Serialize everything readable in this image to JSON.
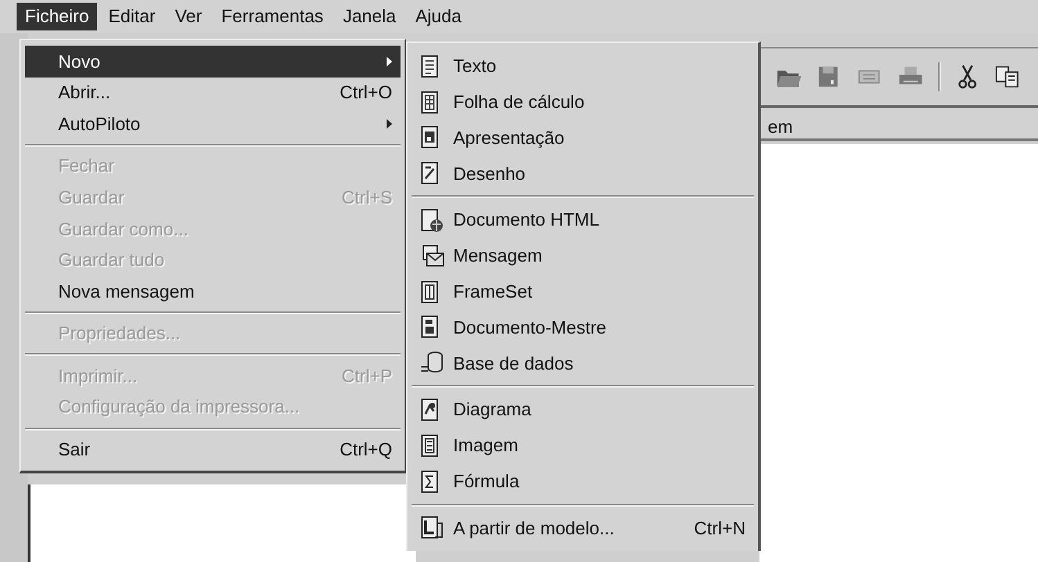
{
  "menubar": [
    {
      "label": "Ficheiro",
      "selected": true
    },
    {
      "label": "Editar",
      "selected": false
    },
    {
      "label": "Ver",
      "selected": false
    },
    {
      "label": "Ferramentas",
      "selected": false
    },
    {
      "label": "Janela",
      "selected": false
    },
    {
      "label": "Ajuda",
      "selected": false
    }
  ],
  "file_menu": [
    {
      "kind": "item",
      "label": "Novo",
      "selected": true,
      "disabled": false,
      "submenu": true
    },
    {
      "kind": "item",
      "label": "Abrir...",
      "shortcut": "Ctrl+O",
      "selected": false,
      "disabled": false,
      "submenu": false
    },
    {
      "kind": "item",
      "label": "AutoPiloto",
      "selected": false,
      "disabled": false,
      "submenu": true
    },
    {
      "kind": "separator"
    },
    {
      "kind": "item",
      "label": "Fechar",
      "selected": false,
      "disabled": true,
      "submenu": false
    },
    {
      "kind": "item",
      "label": "Guardar",
      "shortcut": "Ctrl+S",
      "selected": false,
      "disabled": true,
      "submenu": false
    },
    {
      "kind": "item",
      "label": "Guardar como...",
      "selected": false,
      "disabled": true,
      "submenu": false
    },
    {
      "kind": "item",
      "label": "Guardar tudo",
      "selected": false,
      "disabled": true,
      "submenu": false
    },
    {
      "kind": "item",
      "label": "Nova mensagem",
      "selected": false,
      "disabled": false,
      "submenu": false
    },
    {
      "kind": "separator"
    },
    {
      "kind": "item",
      "label": "Propriedades...",
      "selected": false,
      "disabled": true,
      "submenu": false
    },
    {
      "kind": "separator"
    },
    {
      "kind": "item",
      "label": "Imprimir...",
      "shortcut": "Ctrl+P",
      "selected": false,
      "disabled": true,
      "submenu": false
    },
    {
      "kind": "item",
      "label": "Configuração da impressora...",
      "selected": false,
      "disabled": true,
      "submenu": false
    },
    {
      "kind": "separator"
    },
    {
      "kind": "item",
      "label": "Sair",
      "shortcut": "Ctrl+Q",
      "selected": false,
      "disabled": false,
      "submenu": false
    }
  ],
  "new_submenu": [
    {
      "kind": "item",
      "label": "Texto"
    },
    {
      "kind": "item",
      "label": "Folha de cálculo"
    },
    {
      "kind": "item",
      "label": "Apresentação"
    },
    {
      "kind": "item",
      "label": "Desenho"
    },
    {
      "kind": "separator"
    },
    {
      "kind": "item",
      "label": "Documento HTML"
    },
    {
      "kind": "item",
      "label": "Mensagem"
    },
    {
      "kind": "item",
      "label": "FrameSet"
    },
    {
      "kind": "item",
      "label": "Documento-Mestre"
    },
    {
      "kind": "item",
      "label": "Base de dados"
    },
    {
      "kind": "separator"
    },
    {
      "kind": "item",
      "label": "Diagrama"
    },
    {
      "kind": "item",
      "label": "Imagem"
    },
    {
      "kind": "item",
      "label": "Fórmula"
    },
    {
      "kind": "separator"
    },
    {
      "kind": "item",
      "label": "A partir de modelo...",
      "shortcut": "Ctrl+N"
    }
  ],
  "background": {
    "column_header": "em"
  }
}
